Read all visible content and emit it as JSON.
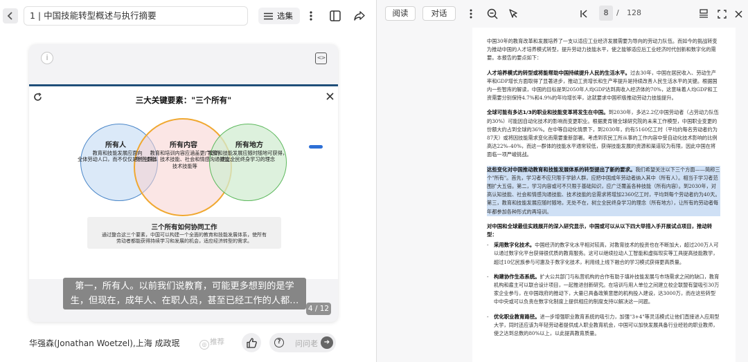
{
  "left": {
    "title": "1 | 中国技能转型概述与执行摘要",
    "select_label": "选集",
    "slide": {
      "title": "三大关键要素：\"三个所有\"",
      "circles": [
        {
          "label": "所有人",
          "text": "教育和技能发展应面向\n全体劳动人口，而不仅仅是学生群体",
          "color": "#cfe2f6"
        },
        {
          "label": "所有内容",
          "text": "教育和培训内容应涵盖更广泛的\n专业技能、技术技能、社会和情感沟通技能、\n技术技能等",
          "color": "#f7d2cf"
        },
        {
          "label": "所有地方",
          "text": "教育和技能发展应随时随地可获得，\n建立全民终身学习的理念",
          "color": "#d2ecd2"
        }
      ],
      "bottom_title": "三个所有如何协同工作",
      "bottom_text": "通过整合这三个要素，中国可以构建一个全面的教育和技能发展体系，使所有劳动者都能获得持续学习和发展的机会，适应经济转型的需求。"
    },
    "caption": "第一，所有人。以前我们说教育，可能更多想到的是学生，但现在，成年人、在职人员，甚至已经工作的人都…",
    "page_badge": "4 / 12",
    "author": "华强森(Jonathan Woetzel),上海 成政珉…",
    "recommend_label": "推荐",
    "ask_label": "问问老"
  },
  "right": {
    "tab_read": "阅读",
    "tab_chat": "对话",
    "page_current": "8",
    "page_separator": "/",
    "page_total": "128",
    "intro": "中国30年的教育改革和发展培养了一支以适应工业经济发展需要为导向的劳动力队伍。而如今的挑战转变为推动中国的人才培养模式转型，提升劳动力技能水平，使之能够适应后工业经济时代创新和数字化的需要。本报告的要点如下：",
    "p1_bold": "人才培养模式的转型或将能帮助中国持续提升人民的生活水平。",
    "p1_text": "过去30年，中国在居民收入、劳动生产率和GDP增长方面取得了显著进步，推动工资增长和生产率提升是持续改善人民生活水平的关键。根据国内一些智库的解读，中国的目标是到2050年人均GDP达到高收入经济体的70%，这意味着人均GDP和工资需要分别保持4.7%和4.9%的年均增长率，这就要求中国积极推动劳动力技能提升。",
    "p2_bold": "全球可能有多达1/3的职业和技能变革将发生在中国。",
    "p2_text": "到2030年，多达2.2亿中国劳动者（占劳动力队伍的30%）可能因自动化技术的影响而变更职业。根据麦肯锡全球研究院的未来工作模型，中国职业变更的份额大约占到全球的36%。在中等自动化情景下，到2030年，约有5160亿工时（平均约每名劳动者约为87天）或将因技能需求变化而需要重新部署。考虑到农民工所从事的工作内容中受自动化技术影响的比例高达22%–40%，而这一群体的技能水平通常较低，获得技能发展的资源和渠道较为有限，因此中国在将面临一项严峻挑战。",
    "p3_bold": "这些变化对中国推动教育和技能发展体系的转型提出了新的要求。",
    "p3_text": "我们希望关注以下三个方面——简称三个\"所有\"。首先，学习者不应只限于学龄人群，应把中国成年劳动者纳入其中（所有人）。相当于学习者范围扩大五倍。第二，学习内容或可不只限于基础知识，应广泛覆盖各种技能（所有内容）。到2030年，对高认知技能、社会和情感沟通技能、技术技能的总需求将增加2360亿工时，平均到每个劳动者约为40天。第三，教育和技能发展应随时随地，无处不在，树立全民终身学习的理念（所有地方），让所有的劳动者每年都参加各种形式的再培训。",
    "sec_title": "对中国和全球最佳实践展开的深入研究显示，中国或可以从以下四大举措入手开展试点项目，推动转型：",
    "bullets": [
      {
        "bold": "采用数字化技术。",
        "text": "中国经济的数字化水平相对较高，对教育技术的投资也在不断加大，超过200万人可以通过数字化平台获得很优质的教育服务。这可以继续拉动人工智能和虚拟现实等工具提高技能教学，超过10亿民族参与可惠及于数字化技术，利用线上线下融合的学习模式获得更高质量。"
      },
      {
        "bold": "构建协作生态系统。",
        "text": "扩大公共部门与私营机构的合作有助于填补技能发展与市场需求之间的缺口，教育机构和雇主可以联合设计项目，一起推进创新研究。在培训与用人单位之间建立校企联盟有望吸引30万家企业参与，在中国政府的推动下，大量已具备政策意愿的机构投入建设，达3000万，而在这些转型中中央或可以负责在数字化制度上提供相应的制度支持以解决这一问题。"
      },
      {
        "bold": "优化职业教育路径。",
        "text": "进一步增强职业教育系统的吸引力，加强\"3+4\"等灵活模式让他们直接进入应用型大学，同时还应该为年轻劳动者提供成人职业教育机会，中国可以加快发展具备行业经验的职业教师，使之达到总数的80%以上，以此提高教育质量。"
      }
    ]
  }
}
